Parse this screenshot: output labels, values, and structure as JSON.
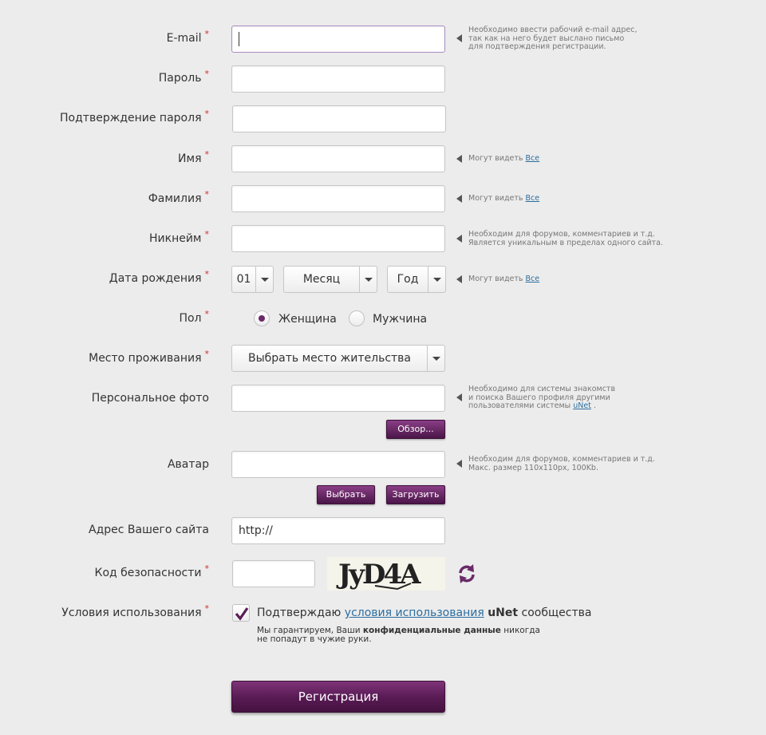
{
  "required_mark": "*",
  "fields": {
    "email": {
      "label": "E-mail",
      "value": "",
      "hint": [
        "Необходимо ввести рабочий e-mail адрес,",
        "так как на него будет выслано письмо",
        "для подтверждения регистрации."
      ]
    },
    "password": {
      "label": "Пароль",
      "value": ""
    },
    "password_confirm": {
      "label": "Подтверждение пароля",
      "value": ""
    },
    "first_name": {
      "label": "Имя",
      "value": "",
      "hint_prefix": "Могут видеть",
      "hint_link": "Все"
    },
    "last_name": {
      "label": "Фамилия",
      "value": "",
      "hint_prefix": "Могут видеть",
      "hint_link": "Все"
    },
    "nickname": {
      "label": "Никнейм",
      "value": "",
      "hint": [
        "Необходим для форумов, комментариев и т.д.",
        "Является уникальным в пределах одного сайта."
      ]
    },
    "birthdate": {
      "label": "Дата рождения",
      "day": "01",
      "month": "Месяц",
      "year": "Год",
      "hint_prefix": "Могут видеть",
      "hint_link": "Все"
    },
    "gender": {
      "label": "Пол",
      "options": [
        "Женщина",
        "Мужчина"
      ],
      "selected": "Женщина"
    },
    "residence": {
      "label": "Место проживания",
      "value": "Выбрать место жительства"
    },
    "photo": {
      "label": "Персональное фото",
      "value": "",
      "browse_button": "Обзор...",
      "hint": [
        "Необходимо для системы знакомств",
        "и поиска Вашего профиля другими",
        "пользователями системы"
      ],
      "hint_link": "uNet",
      "hint_suffix": "."
    },
    "avatar": {
      "label": "Аватар",
      "value": "",
      "choose_button": "Выбрать",
      "upload_button": "Загрузить",
      "hint": [
        "Необходим для форумов, комментариев и т.д.",
        "Макс. размер 110x110px, 100Kb."
      ]
    },
    "website": {
      "label": "Адрес Вашего сайта",
      "value": "http://"
    },
    "captcha": {
      "label": "Код безопасности",
      "value": "",
      "image_text": "JyD4A"
    },
    "terms": {
      "label": "Условия использования",
      "checked": true,
      "text_before": "Подтверждаю",
      "link": "условия использования",
      "brand": "uNet",
      "text_after": "сообщества",
      "note_before": "Мы гарантируем, Ваши",
      "note_bold": "конфиденциальные данные",
      "note_after": "никогда",
      "note_line2": "не попадут в чужие руки."
    }
  },
  "submit_label": "Регистрация",
  "colors": {
    "accent": "#5a1c56",
    "link": "#2c6ea0",
    "required": "#d0302a",
    "background": "#ececec"
  }
}
